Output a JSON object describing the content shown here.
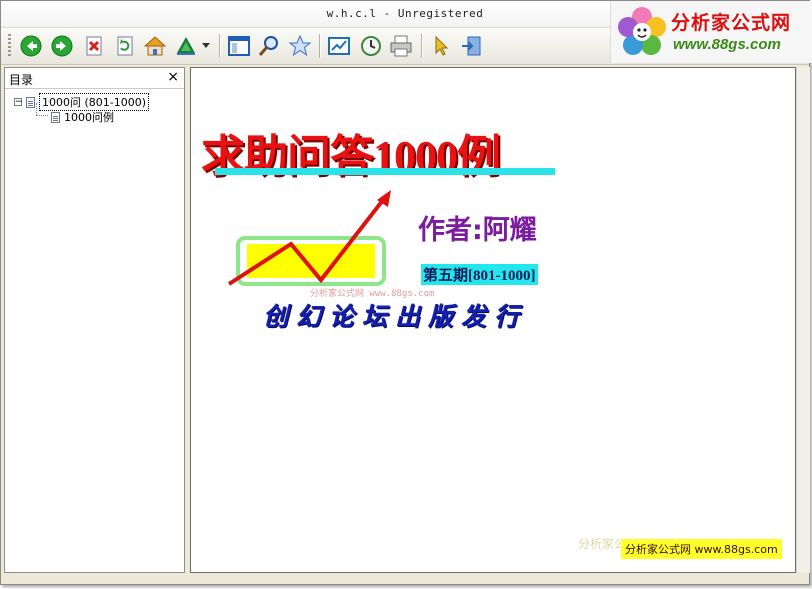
{
  "window": {
    "title": "w.h.c.l - Unregistered"
  },
  "toolbar": {
    "buttons": [
      {
        "name": "back-icon",
        "color": "#2aa632"
      },
      {
        "name": "forward-icon",
        "color": "#2aa632"
      },
      {
        "name": "stop-icon",
        "color": "#d42020"
      },
      {
        "name": "refresh-icon",
        "color": "#2a9a3a"
      },
      {
        "name": "home-icon",
        "color": "#e8a020"
      },
      {
        "name": "locate-icon",
        "color": "#1a7a3a"
      },
      {
        "name": "toggle-toc-icon",
        "color": "#1f5fb8"
      },
      {
        "name": "search-icon",
        "color": "#2050a0"
      },
      {
        "name": "favorites-icon",
        "color": "#3a70c8"
      },
      {
        "name": "export-icon",
        "color": "#1f6fb8"
      },
      {
        "name": "history-icon",
        "color": "#3a8a3a"
      },
      {
        "name": "print-icon",
        "color": "#7a7a7a"
      },
      {
        "name": "pointer-icon",
        "color": "#e8b020"
      },
      {
        "name": "exit-icon",
        "color": "#2a6ab8"
      }
    ]
  },
  "logo": {
    "text1": "分析家公式网",
    "text2": "www.88gs.com",
    "colors": {
      "text1": "#d81010",
      "text2": "#3a8a1a"
    }
  },
  "sidebar": {
    "title": "目录",
    "close_glyph": "×",
    "tree": [
      {
        "label": "1000问 (801-1000)",
        "expanded": true,
        "toggle": "−"
      },
      {
        "label": "1000问例"
      }
    ]
  },
  "page": {
    "headline": "求助问答1000例",
    "author": "作者:阿耀",
    "issue": "第五期[801-1000]",
    "publisher": "创幻论坛出版发行",
    "watermark_mid": "分析家公式网 www.88gs.com",
    "watermark_bottom_a": "分析家公",
    "watermark_bottom_b": "分析家公式网 www.88gs.com",
    "colors": {
      "headline": "#e81212",
      "underline": "#29e3e8",
      "author": "#7a1ba0",
      "issue_bg": "#22e8ee",
      "publisher": "#1420b0",
      "chart_box": "#ffff00",
      "chart_border": "#8ee68a",
      "arrow": "#e01010"
    }
  }
}
